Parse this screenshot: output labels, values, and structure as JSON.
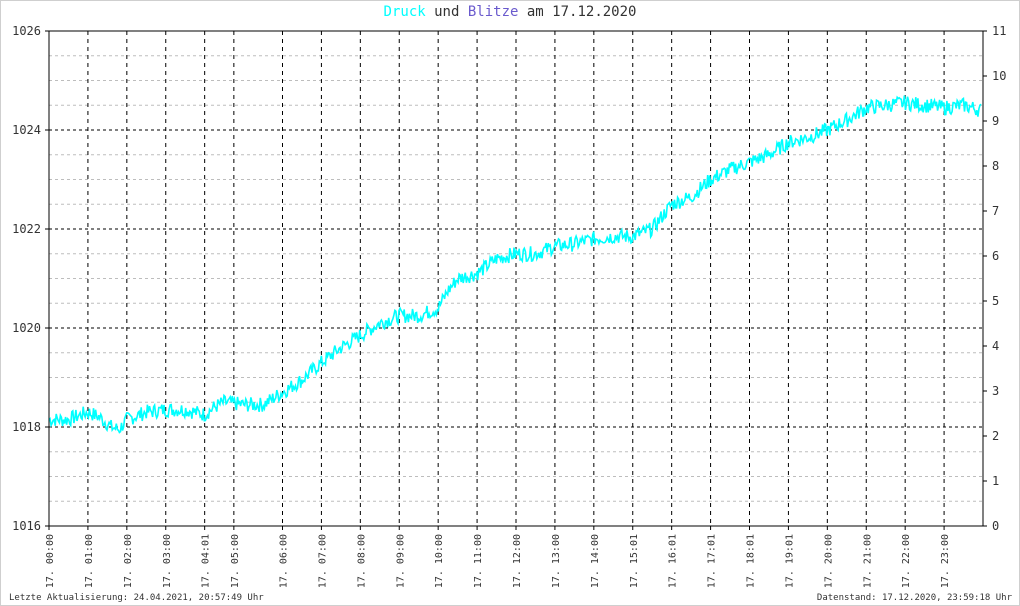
{
  "title": {
    "series1": "Druck",
    "conj": "und",
    "series2": "Blitze",
    "prep": "am",
    "date": "17.12.2020",
    "color1": "#00ffff",
    "color2": "#6a5acd",
    "text_color": "#333333"
  },
  "footer": {
    "left": "Letzte Aktualisierung: 24.04.2021, 20:57:49 Uhr",
    "right": "Datenstand: 17.12.2020, 23:59:18 Uhr"
  },
  "chart_data": {
    "type": "line",
    "x_unit": "hours",
    "xlim": [
      0,
      24
    ],
    "ylim_left": [
      1016,
      1026
    ],
    "ylim_right": [
      0,
      11
    ],
    "left_ticks": [
      "1016",
      "1018",
      "1020",
      "1022",
      "1024",
      "1026"
    ],
    "right_ticks": [
      "0",
      "1",
      "2",
      "3",
      "4",
      "5",
      "6",
      "7",
      "8",
      "9",
      "10",
      "11"
    ],
    "x_ticks": [
      {
        "h": 0.0,
        "label": "17. 00:00"
      },
      {
        "h": 1.0,
        "label": "17. 01:00"
      },
      {
        "h": 2.0,
        "label": "17. 02:00"
      },
      {
        "h": 3.0,
        "label": "17. 03:00"
      },
      {
        "h": 4.0,
        "label": "17. 04:01"
      },
      {
        "h": 4.75,
        "label": "17. 05:00"
      },
      {
        "h": 6.0,
        "label": "17. 06:00"
      },
      {
        "h": 7.0,
        "label": "17. 07:00"
      },
      {
        "h": 8.0,
        "label": "17. 08:00"
      },
      {
        "h": 9.0,
        "label": "17. 09:00"
      },
      {
        "h": 10.0,
        "label": "17. 10:00"
      },
      {
        "h": 11.0,
        "label": "17. 11:00"
      },
      {
        "h": 12.0,
        "label": "17. 12:00"
      },
      {
        "h": 13.0,
        "label": "17. 13:00"
      },
      {
        "h": 14.0,
        "label": "17. 14:00"
      },
      {
        "h": 15.0,
        "label": "17. 15:01"
      },
      {
        "h": 16.0,
        "label": "17. 16:01"
      },
      {
        "h": 17.0,
        "label": "17. 17:01"
      },
      {
        "h": 18.0,
        "label": "17. 18:01"
      },
      {
        "h": 19.0,
        "label": "17. 19:01"
      },
      {
        "h": 20.0,
        "label": "17. 20:00"
      },
      {
        "h": 21.0,
        "label": "17. 21:00"
      },
      {
        "h": 22.0,
        "label": "17. 22:00"
      },
      {
        "h": 23.0,
        "label": "17. 23:00"
      }
    ],
    "grid": true,
    "series": [
      {
        "name": "Druck",
        "color": "#00ffff",
        "axis": "left",
        "x": [
          0.0,
          0.5,
          1.0,
          1.3,
          1.6,
          1.8,
          2.0,
          2.5,
          3.0,
          3.5,
          4.0,
          4.25,
          4.5,
          5.0,
          5.5,
          6.0,
          6.5,
          7.0,
          7.5,
          8.0,
          8.5,
          9.0,
          9.5,
          10.0,
          10.25,
          10.5,
          11.0,
          11.5,
          12.0,
          12.5,
          13.0,
          13.5,
          14.0,
          14.5,
          15.0,
          15.5,
          16.0,
          16.5,
          17.0,
          17.5,
          18.0,
          18.5,
          19.0,
          19.5,
          20.0,
          20.5,
          21.0,
          21.5,
          22.0,
          22.5,
          23.0,
          23.5,
          23.95
        ],
        "y": [
          1018.15,
          1018.15,
          1018.3,
          1018.2,
          1018.0,
          1017.95,
          1018.15,
          1018.3,
          1018.35,
          1018.35,
          1018.25,
          1018.4,
          1018.5,
          1018.45,
          1018.45,
          1018.7,
          1018.95,
          1019.3,
          1019.6,
          1019.85,
          1020.1,
          1020.25,
          1020.25,
          1020.4,
          1020.75,
          1021.0,
          1021.1,
          1021.4,
          1021.5,
          1021.5,
          1021.65,
          1021.7,
          1021.8,
          1021.85,
          1021.85,
          1022.0,
          1022.5,
          1022.65,
          1023.0,
          1023.2,
          1023.35,
          1023.5,
          1023.75,
          1023.85,
          1024.0,
          1024.2,
          1024.45,
          1024.5,
          1024.55,
          1024.5,
          1024.45,
          1024.5,
          1024.4
        ]
      }
    ]
  }
}
